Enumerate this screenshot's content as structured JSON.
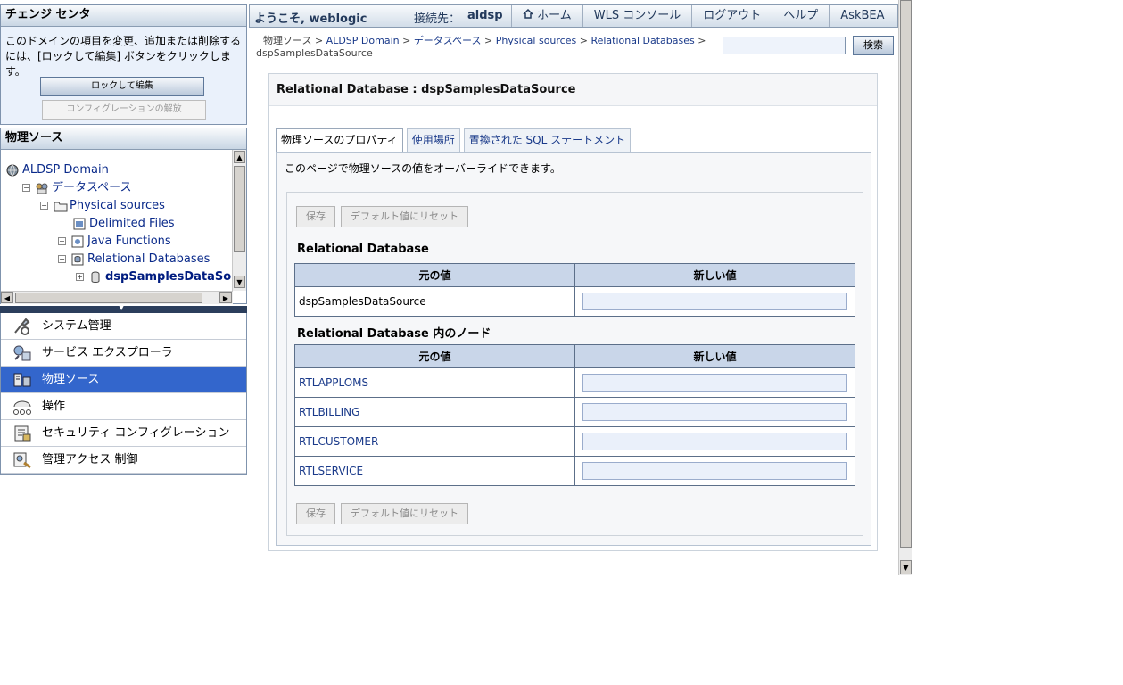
{
  "change_center": {
    "title": "チェンジ センタ",
    "description": "このドメインの項目を変更、追加または削除するには、[ロックして編集] ボタンをクリックします。",
    "lock_button": "ロックして編集",
    "release_button": "コンフィグレーションの解放"
  },
  "tree": {
    "title": "物理ソース",
    "nodes": [
      {
        "label": "ALDSP Domain",
        "level": 0
      },
      {
        "label": "データスペース",
        "level": 1,
        "expander": "−"
      },
      {
        "label": "Physical sources",
        "level": 2,
        "expander": "−"
      },
      {
        "label": "Delimited Files",
        "level": 3
      },
      {
        "label": "Java Functions",
        "level": 3,
        "expander": "+"
      },
      {
        "label": "Relational Databases",
        "level": 3,
        "expander": "−"
      },
      {
        "label": "dspSamplesDataSource",
        "level": 4,
        "expander": "+",
        "selected": true
      }
    ]
  },
  "nav": {
    "items": [
      {
        "label": "システム管理",
        "icon": "tools-icon"
      },
      {
        "label": "サービス エクスプローラ",
        "icon": "service-explorer-icon"
      },
      {
        "label": "物理ソース",
        "icon": "physical-sources-icon",
        "active": true
      },
      {
        "label": "操作",
        "icon": "operations-icon"
      },
      {
        "label": "セキュリティ コンフィグレーション",
        "icon": "security-config-icon"
      },
      {
        "label": "管理アクセス 制御",
        "icon": "admin-access-icon"
      }
    ]
  },
  "header": {
    "welcome": "ようこそ, weblogic",
    "connect_label": "接続先：",
    "connect_value": "aldsp",
    "links": [
      "ホーム",
      "WLS コンソール",
      "ログアウト",
      "ヘルプ",
      "AskBEA"
    ]
  },
  "breadcrumb": {
    "items": [
      "物理ソース",
      "ALDSP Domain",
      "データスペース",
      "Physical sources",
      "Relational Databases",
      "dspSamplesDataSource"
    ],
    "separator": ">"
  },
  "search": {
    "value": "",
    "button": "検索"
  },
  "content": {
    "title": "Relational Database : dspSamplesDataSource",
    "tabs": [
      "物理ソースのプロパティ",
      "使用場所",
      "置換された SQL ステートメント"
    ],
    "intro": "このページで物理ソースの値をオーバーライドできます。",
    "save_button": "保存",
    "reset_button": "デフォルト値にリセット",
    "section1_title": "Relational Database",
    "section2_title": "Relational Database 内のノード",
    "col_original": "元の値",
    "col_new": "新しい値",
    "section1_rows": [
      {
        "original": "dspSamplesDataSource",
        "new": ""
      }
    ],
    "section2_rows": [
      {
        "original": "RTLAPPLOMS",
        "new": ""
      },
      {
        "original": "RTLBILLING",
        "new": ""
      },
      {
        "original": "RTLCUSTOMER",
        "new": ""
      },
      {
        "original": "RTLSERVICE",
        "new": ""
      }
    ]
  },
  "colors": {
    "nav_active": "#3366cc",
    "header_bg": "#d2dde9",
    "table_header": "#c9d6e9",
    "link": "#1a3a8a"
  }
}
